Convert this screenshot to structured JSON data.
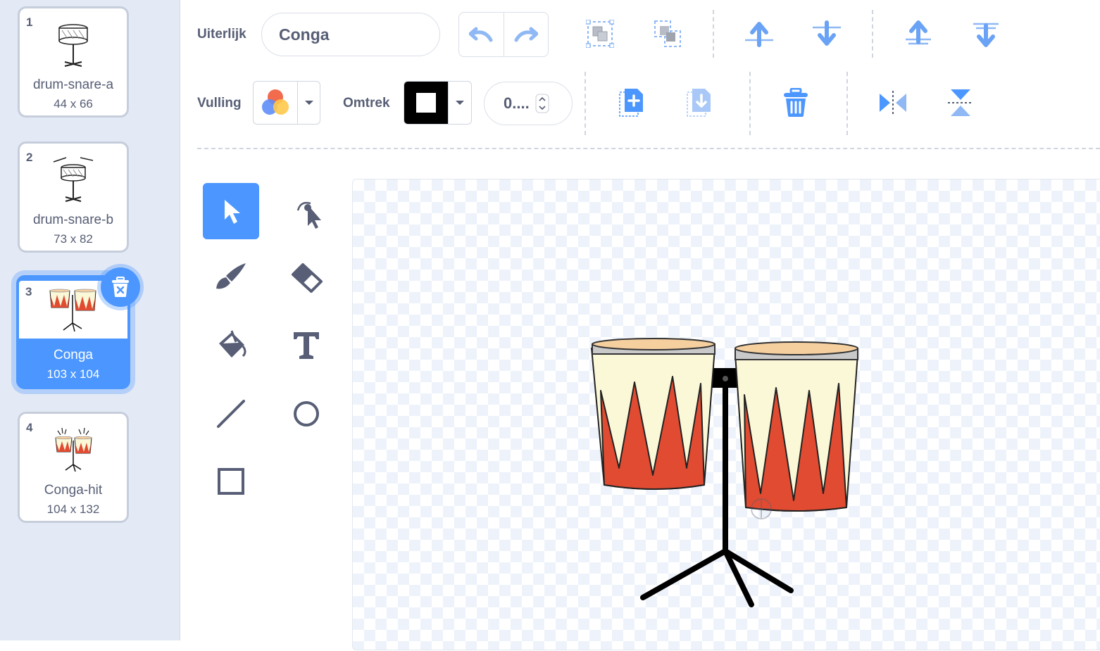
{
  "costumes": [
    {
      "index": "1",
      "name": "drum-snare-a",
      "size": "44 x 66"
    },
    {
      "index": "2",
      "name": "drum-snare-b",
      "size": "73 x 82"
    },
    {
      "index": "3",
      "name": "Conga",
      "size": "103 x 104",
      "selected": true
    },
    {
      "index": "4",
      "name": "Conga-hit",
      "size": "104 x 132"
    }
  ],
  "toolbar": {
    "costume_label": "Uiterlijk",
    "costume_name": "Conga",
    "fill_label": "Vulling",
    "outline_label": "Omtrek",
    "outline_width": "0...."
  },
  "icons": {
    "undo": "undo-icon",
    "redo": "redo-icon",
    "group": "group-icon",
    "ungroup": "ungroup-icon",
    "forward": "forward-icon",
    "backward": "backward-icon",
    "front": "front-icon",
    "back": "back-icon",
    "copy": "copy-icon",
    "paste": "paste-icon",
    "delete": "trash-icon",
    "flip_h": "flip-horizontal-icon",
    "flip_v": "flip-vertical-icon"
  },
  "tools": [
    "select",
    "reshape",
    "brush",
    "eraser",
    "fill",
    "text",
    "line",
    "circle",
    "rectangle"
  ],
  "colors": {
    "accent": "#4c97ff",
    "sidebar_bg": "#e3e9f5",
    "text": "#575e75",
    "conga_red": "#e04b31",
    "conga_cream": "#fbf8d8",
    "conga_skin": "#f6cf9f"
  }
}
